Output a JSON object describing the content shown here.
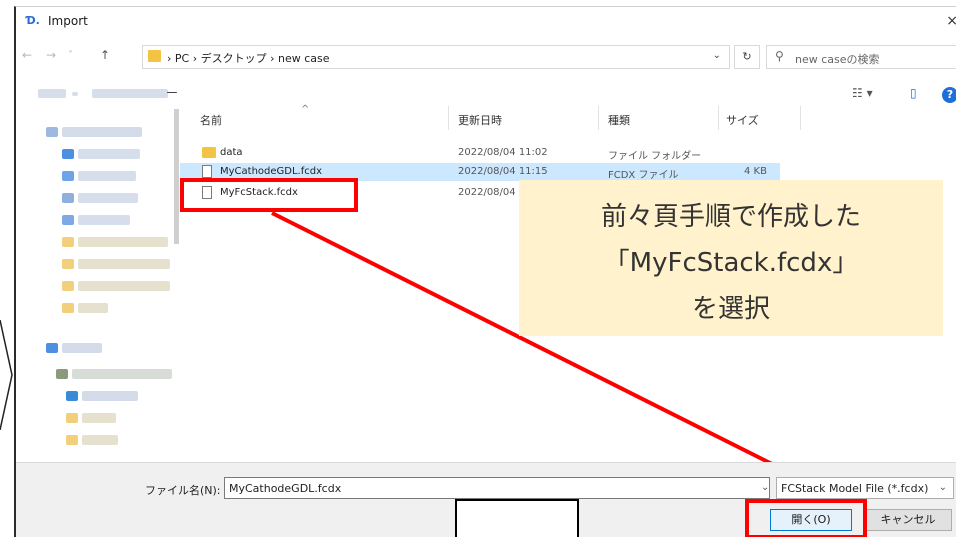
{
  "window": {
    "title": "Import",
    "title_icon": "Ɗ.",
    "close": "×"
  },
  "nav": {
    "back": "←",
    "forward": "→",
    "dropdown": "˅",
    "up": "↑",
    "path": "› PC › デスクトップ › new case",
    "address_dropdown": "⌄",
    "refresh": "↻",
    "search_placeholder": "new caseの検索"
  },
  "toolbar": {
    "view_icon": "☷ ▾",
    "pane_icon": "▯",
    "help": "?",
    "new_folder_suffix": "ー"
  },
  "columns": {
    "name": "名前",
    "modified": "更新日時",
    "type": "種類",
    "size": "サイズ"
  },
  "files": [
    {
      "name": "data",
      "modified": "2022/08/04 11:02",
      "type": "ファイル フォルダー",
      "size": "",
      "kind": "folder",
      "selected": false
    },
    {
      "name": "MyCathodeGDL.fcdx",
      "modified": "2022/08/04 11:15",
      "type": "FCDX ファイル",
      "size": "4 KB",
      "kind": "file",
      "selected": true
    },
    {
      "name": "MyFcStack.fcdx",
      "modified": "2022/08/04",
      "type": "",
      "size": "",
      "kind": "file",
      "selected": false
    }
  ],
  "callout": {
    "lines": [
      "前々頁手順で作成した",
      "「MyFcStack.fcdx」",
      "を選択"
    ]
  },
  "bottom": {
    "filename_label": "ファイル名(N):",
    "filename_value": "MyCathodeGDL.fcdx",
    "filter_value": "FCStack Model File (*.fcdx)",
    "open_button": "開く(O)",
    "cancel_button": "キャンセル"
  },
  "colors": {
    "accent": "#ff0000",
    "selection": "#cce8ff",
    "callout_bg": "#fff2cc"
  }
}
